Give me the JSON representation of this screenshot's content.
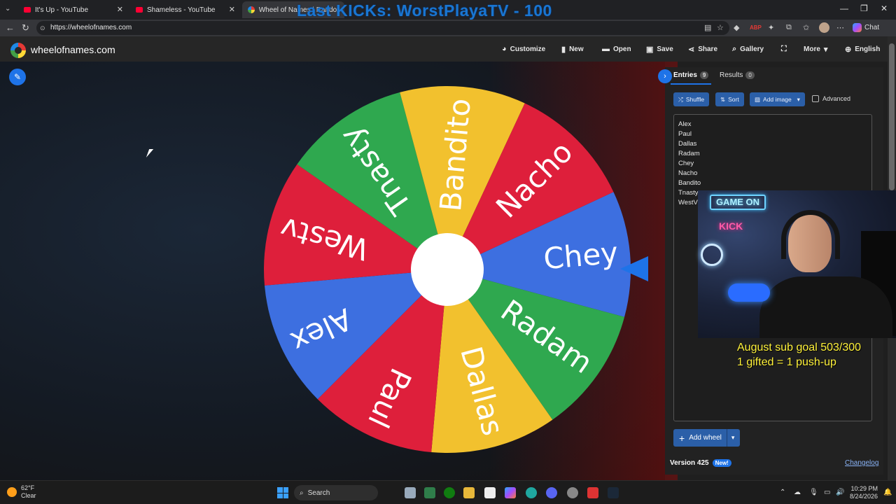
{
  "browser": {
    "tabs": [
      {
        "title": "It's Up - YouTube"
      },
      {
        "title": "Shameless - YouTube"
      },
      {
        "title": "Wheel of Names | Random name"
      }
    ],
    "url": "https://wheelofnames.com",
    "chat_label": "Chat"
  },
  "stream_overlay": {
    "title": "Last KICKs: WorstPlayaTV - 100",
    "neon_sign_1": "GAME ON",
    "neon_sign_2": "KICK",
    "sub_goal_line1": "August sub goal 503/300",
    "sub_goal_line2": "1 gifted = 1 push-up"
  },
  "app": {
    "brand": "wheelofnames.com",
    "menu": {
      "customize": "Customize",
      "new": "New",
      "open": "Open",
      "save": "Save",
      "share": "Share",
      "gallery": "Gallery",
      "more": "More",
      "language": "English"
    }
  },
  "wheel": {
    "segments": [
      {
        "label": "Chey",
        "color": "#3d6fe0"
      },
      {
        "label": "Radam",
        "color": "#2fa84f"
      },
      {
        "label": "Dallas",
        "color": "#f2c12e"
      },
      {
        "label": "Paul",
        "color": "#de1f3b"
      },
      {
        "label": "Alex",
        "color": "#3d6fe0"
      },
      {
        "label": "Westv",
        "color": "#de1f3b"
      },
      {
        "label": "Tnasty",
        "color": "#2fa84f"
      },
      {
        "label": "Bandito",
        "color": "#f2c12e"
      },
      {
        "label": "Nacho",
        "color": "#de1f3b"
      }
    ]
  },
  "panel": {
    "entries_tab": "Entries",
    "entries_count": "9",
    "results_tab": "Results",
    "results_count": "0",
    "shuffle": "Shuffle",
    "sort": "Sort",
    "add_image": "Add image",
    "advanced": "Advanced",
    "entries": [
      "Alex",
      "Paul",
      "Dallas",
      "Radam",
      "Chey",
      "Nacho",
      "Bandito",
      "Tnasty",
      "WestV"
    ],
    "add_wheel": "Add wheel",
    "version": "Version 425",
    "new_badge": "New!",
    "changelog": "Changelog"
  },
  "taskbar": {
    "temp": "62°F",
    "weather": "Clear",
    "search": "Search",
    "time": "10:29 PM",
    "date": "8/24/2026"
  }
}
